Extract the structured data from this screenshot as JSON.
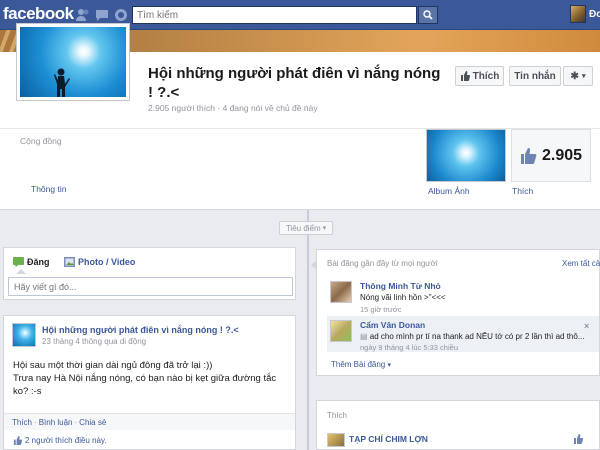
{
  "topbar": {
    "logo": "facebook",
    "search_placeholder": "Tìm kiếm",
    "user_name": "Đo"
  },
  "page": {
    "title": "Hội những người phát điên vì nắng nóng ! ?.<",
    "stats": "2.905 người thích · 4 đang nói về chủ đề này",
    "category": "Cộng đồng",
    "info_link": "Thông tin",
    "like_button": "Thích",
    "message_button": "Tin nhắn",
    "album_label": "Album Ảnh",
    "likes_count": "2.905",
    "likes_label": "Thích"
  },
  "timeline": {
    "highlights_label": "Tiêu điểm"
  },
  "composer": {
    "tab_status": "Đăng",
    "tab_photo": "Photo / Video",
    "placeholder": "Hãy viết gì đó..."
  },
  "post": {
    "author": "Hội những người phát điên vì nắng nóng ! ?.<",
    "meta": "23 tháng 4 thông qua di động",
    "body_line1": "Hội sau một thời gian dài ngủ đông đã trở lại :))",
    "body_line2": "Trưa nay Hà Nội nắng nóng, có bạn nào bị kẹt giữa đường tắc ko? :-s",
    "action_like": "Thích",
    "action_comment": "Bình luận",
    "action_share": "Chia sẻ",
    "likes_text": "2 người thích điều này."
  },
  "recent_posts": {
    "title": "Bài đăng gần đây từ mọi người",
    "see_all": "Xem tất cả",
    "items": [
      {
        "name": "Thông Minh Từ Nhỏ",
        "text": "Nóng vãi linh hồn >\"<<<",
        "time": "15 giờ trước"
      },
      {
        "name": "Cẩm Vân Donan",
        "text": "ad cho mình pr tí na thank ad NẾU tớ có pr 2 lần thì ad thô...",
        "time": "ngày 9 tháng 4 lúc 5:33 chiều"
      }
    ],
    "more": "Thêm Bài đăng"
  },
  "like_card": {
    "title": "Thích",
    "item_name": "TẠP CHÍ CHIM LỢN"
  },
  "colors": {
    "brand": "#3b5998",
    "link": "#3b5998",
    "meta": "#90949c",
    "background": "#e9ebee"
  }
}
